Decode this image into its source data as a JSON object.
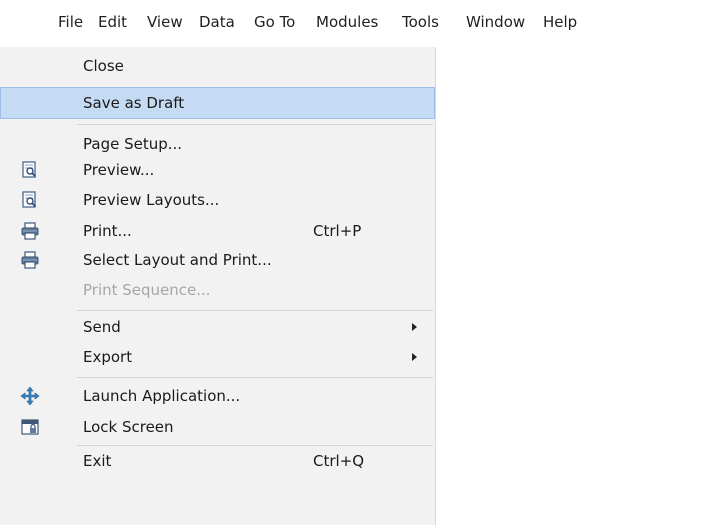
{
  "menubar": {
    "items": [
      {
        "label": "File"
      },
      {
        "label": "Edit"
      },
      {
        "label": "View"
      },
      {
        "label": "Data"
      },
      {
        "label": "Go To"
      },
      {
        "label": "Modules"
      },
      {
        "label": "Tools"
      },
      {
        "label": "Window"
      },
      {
        "label": "Help"
      }
    ]
  },
  "file_menu": {
    "items": [
      {
        "label": "Close"
      },
      {
        "label": "Save as Draft",
        "highlighted": true
      },
      {
        "label": "Page Setup..."
      },
      {
        "label": "Preview...",
        "icon": "preview-icon"
      },
      {
        "label": "Preview Layouts...",
        "icon": "preview-layouts-icon"
      },
      {
        "label": "Print...",
        "icon": "printer-icon",
        "shortcut": "Ctrl+P"
      },
      {
        "label": "Select Layout and Print...",
        "icon": "printer-icon"
      },
      {
        "label": "Print Sequence...",
        "disabled": true
      },
      {
        "label": "Send",
        "submenu": true
      },
      {
        "label": "Export",
        "submenu": true
      },
      {
        "label": "Launch Application...",
        "icon": "launch-app-icon"
      },
      {
        "label": "Lock Screen",
        "icon": "lock-screen-icon"
      },
      {
        "label": "Exit",
        "shortcut": "Ctrl+Q"
      }
    ]
  },
  "colors": {
    "highlight_bg": "#c5daf3",
    "highlight_border": "#9cbde5",
    "menu_bg": "#f2f2f2",
    "disabled_text": "#a6a6a6"
  }
}
